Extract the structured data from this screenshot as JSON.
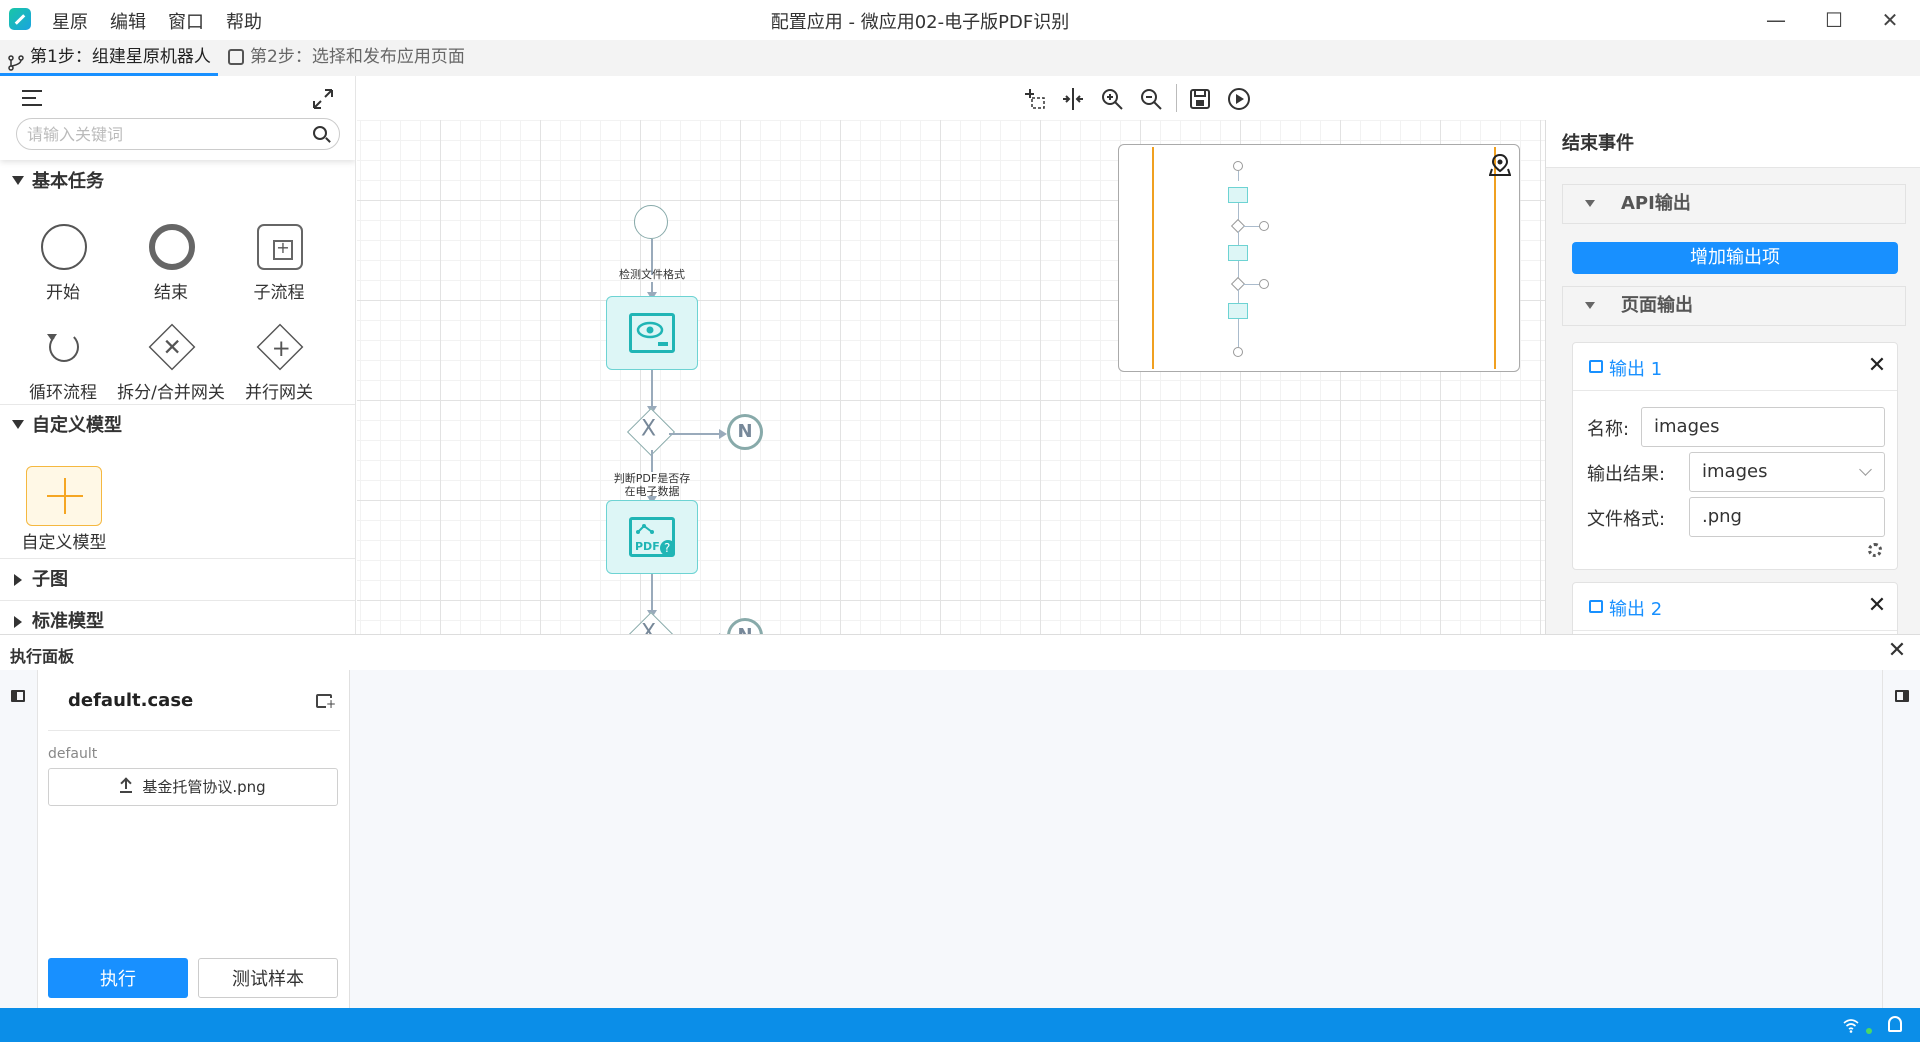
{
  "menu": [
    "星原",
    "编辑",
    "窗口",
    "帮助"
  ],
  "window": {
    "title": "配置应用 - 微应用02-电子版PDF识别",
    "minimize": "—",
    "maximize": "☐",
    "close": "✕"
  },
  "steps": [
    {
      "label": "第1步：组建星原机器人"
    },
    {
      "label": "第2步：选择和发布应用页面"
    }
  ],
  "palette": {
    "search_placeholder": "请输入关键词",
    "sections": {
      "basic": "基本任务",
      "custom": "自定义模型",
      "subgraph": "子图",
      "standard": "标准模型"
    },
    "tools": {
      "start": "开始",
      "end": "结束",
      "subprocess": "子流程",
      "loop": "循环流程",
      "split_merge": "拆分/合并网关",
      "parallel": "并行网关",
      "custom_model": "自定义模型"
    }
  },
  "diagram": {
    "task1_label": "检测文件格式",
    "task2_label_line1": "判断PDF是否存",
    "task2_label_line2": "在电子数据",
    "gateway_mark": "X",
    "error_mark": "N",
    "pdf_text": "PDF"
  },
  "right_panel": {
    "title": "结束事件",
    "api_section": "API输出",
    "add_button": "增加输出项",
    "page_section": "页面输出",
    "outputs": [
      {
        "title": "输出 1",
        "name_label": "名称:",
        "name_value": "images",
        "result_label": "输出结果:",
        "result_value": "images",
        "format_label": "文件格式:",
        "format_value": ".png"
      },
      {
        "title": "输出 2"
      }
    ],
    "close_mark": "✕"
  },
  "exec_panel": {
    "title": "执行面板",
    "close_mark": "✕",
    "case_title": "default.case",
    "case_sub": "default",
    "file_name": "基金托管协议.png",
    "run_button": "执行",
    "sample_button": "测试样本"
  },
  "colors": {
    "accent": "#1890ff",
    "status_bar": "#0b8ee8",
    "task_fill": "#ddf6f6",
    "task_stroke": "#20b5b5",
    "minimap_edge": "#f0a020"
  }
}
